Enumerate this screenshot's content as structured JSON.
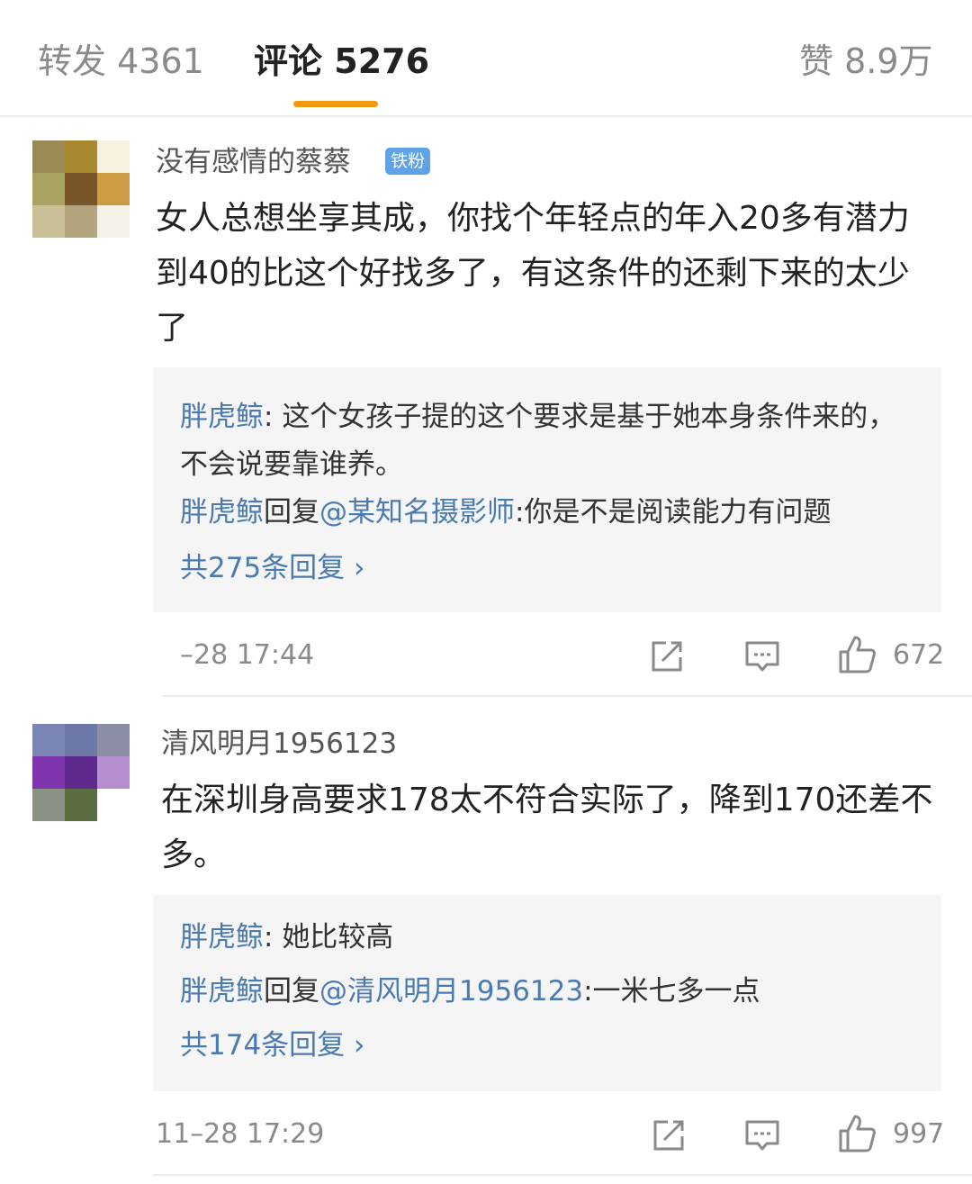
{
  "tabs": [
    {
      "label": "转发",
      "count": "4361"
    },
    {
      "label": "评论",
      "count": "5276"
    },
    {
      "label": "赞",
      "count": "8.9万"
    }
  ],
  "comments": [
    {
      "username": "没有感情的蔡蔡",
      "badge": "铁粉",
      "avatar_colors": [
        "#9a8a55",
        "#a88930",
        "#f6f0df",
        "#a8a361",
        "#78562a",
        "#cc9c45",
        "#c9bf97",
        "#b2a47c",
        "#f6f2e8"
      ],
      "text": "女人总想坐享其成，你找个年轻点的年入20多有潜力到40的比这个好找多了，有这条件的还剩下来的太少了",
      "replies": [
        {
          "author": "胖虎鲸",
          "connector": ": ",
          "target": "",
          "text": "这个女孩子提的这个要求是基于她本身条件来的，不会说要靠谁养。"
        },
        {
          "author": "胖虎鲸",
          "connector": "回复",
          "target": "@某知名摄影师",
          "text": ":你是不是阅读能力有问题"
        }
      ],
      "more_replies": "共275条回复 ›",
      "time": "–28 17:44",
      "likes": "672"
    },
    {
      "username": "清风明月1956123",
      "badge": "",
      "avatar_colors": [
        "#7a86b6",
        "#6c79a6",
        "#8c8ea6",
        "#7e34ac",
        "#5e2a8e",
        "#b68ed0",
        "#8a9283",
        "#5b6c41",
        "#ffffff"
      ],
      "text": "在深圳身高要求178太不符合实际了，降到170还差不多。",
      "replies": [
        {
          "author": "胖虎鲸",
          "connector": ": ",
          "target": "",
          "text": "她比较高"
        },
        {
          "author": "胖虎鲸",
          "connector": "回复",
          "target": "@清风明月1956123",
          "text": ":一米七多一点"
        }
      ],
      "more_replies": "共174条回复 ›",
      "time": "11–28 17:29",
      "likes": "997"
    }
  ],
  "icons": {
    "share": "share-icon",
    "comment": "comment-icon",
    "like": "thumbs-up-icon"
  }
}
